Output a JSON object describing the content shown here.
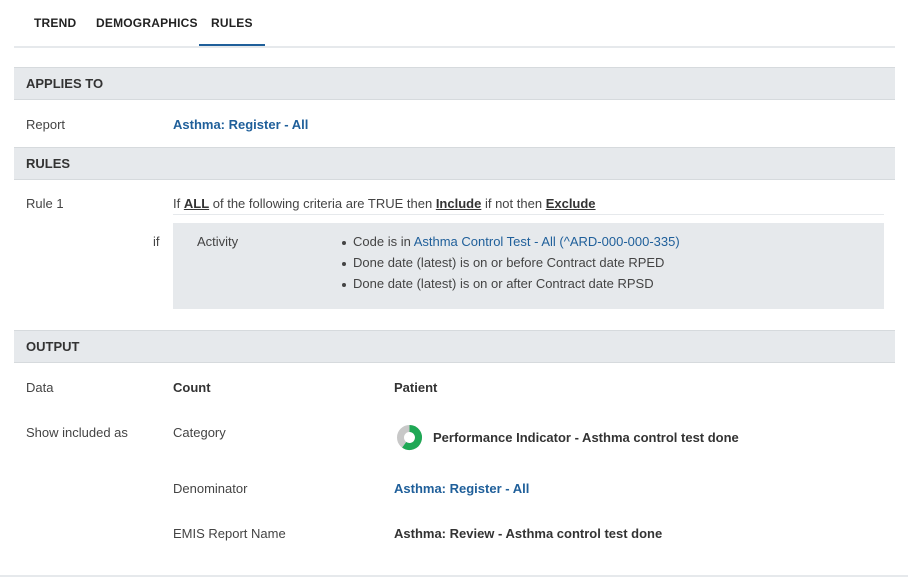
{
  "tabs": [
    {
      "label": "TREND"
    },
    {
      "label": "DEMOGRAPHICS"
    },
    {
      "label": "RULES",
      "active": true
    }
  ],
  "applies_to": {
    "header": "APPLIES TO",
    "report_label": "Report",
    "report_value": "Asthma: Register - All"
  },
  "rules": {
    "header": "RULES",
    "rule_label": "Rule 1",
    "sentence": {
      "if": "If",
      "all": "ALL",
      "middle": "of the following criteria are TRUE then",
      "include": "Include",
      "if_not": "if not then",
      "exclude": "Exclude"
    },
    "if_label": "if",
    "criteria": {
      "type": "Activity",
      "code_prefix": "Code is in",
      "code_link": "Asthma Control Test - All (^ARD-000-000-335)",
      "date1": "Done date (latest) is on or before Contract date RPED",
      "date2": "Done date (latest) is on or after Contract date RPSD"
    }
  },
  "output": {
    "header": "OUTPUT",
    "data_label": "Data",
    "count": "Count",
    "patient": "Patient",
    "show_included_label": "Show included as",
    "category_label": "Category",
    "category_value": "Performance Indicator - Asthma control test done",
    "denominator_label": "Denominator",
    "denominator_value": "Asthma: Register - All",
    "emis_label": "EMIS Report Name",
    "emis_value": "Asthma: Review - Asthma control test done"
  },
  "colors": {
    "accent": "#1f5f9a",
    "indicator_green": "#1fa855",
    "indicator_grey": "#c8c8c8"
  },
  "icons": {
    "category": "performance-indicator-donut-icon"
  }
}
